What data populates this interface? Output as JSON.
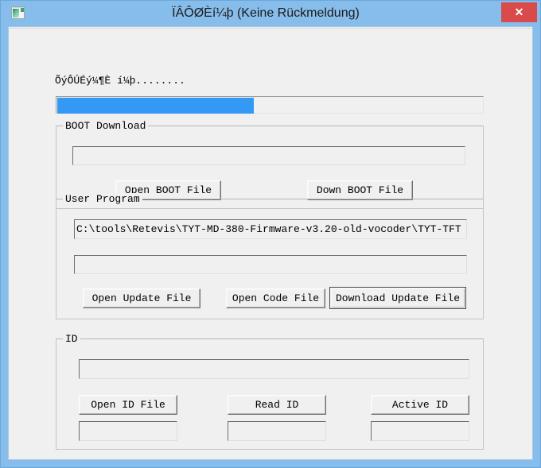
{
  "window": {
    "title": "ÏÂÔØÈí¼þ (Keine Rückmeldung)",
    "app_icon": "application-window-icon",
    "close_label": "✕",
    "frame_color": "#87bdeb",
    "close_color": "#d94a4a"
  },
  "status": {
    "label": "ÕýÔÚÉý¼¶È í¼þ........"
  },
  "progress": {
    "name": "upgrade-progress-bar",
    "percent": 46,
    "fill_color": "#3399f5"
  },
  "boot_group": {
    "title": "BOOT Download",
    "path_field_value": "",
    "path_field_placeholder": "",
    "open_button": "Open BOOT File",
    "down_button": "Down BOOT File"
  },
  "user_program_group": {
    "title": "User Program",
    "path_field_value": "C:\\tools\\Retevis\\TYT-MD-380-Firmware-v3.20-old-vocoder\\TYT-TFT",
    "status_field_value": "",
    "open_update_button": "Open Update File",
    "open_code_button": "Open Code File",
    "download_update_button": "Download Update File"
  },
  "id_group": {
    "title": "ID",
    "path_field_value": "",
    "open_id_button": "Open ID File",
    "read_id_button": "Read ID",
    "active_id_button": "Active ID",
    "open_id_value": "",
    "read_id_value": "",
    "active_id_value": ""
  }
}
